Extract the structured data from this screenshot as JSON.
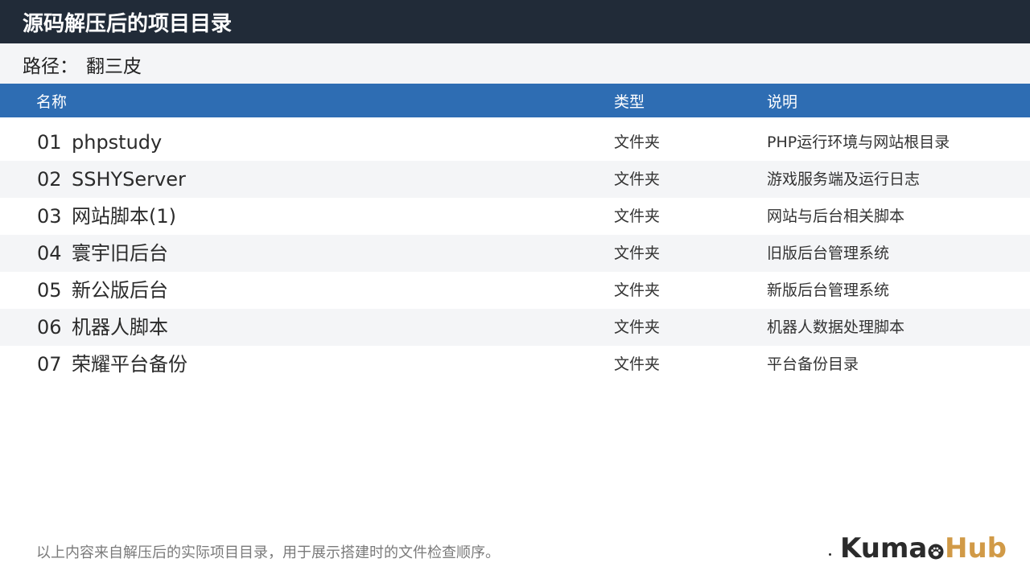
{
  "header": {
    "title": "源码解压后的项目目录"
  },
  "path": {
    "label": "路径：",
    "value": "翻三皮"
  },
  "table": {
    "columns": {
      "name": "名称",
      "type": "类型",
      "desc": "说明"
    },
    "rows": [
      {
        "num": "01",
        "name": "phpstudy",
        "type": "文件夹",
        "desc": "PHP运行环境与网站根目录"
      },
      {
        "num": "02",
        "name": "SSHYServer",
        "type": "文件夹",
        "desc": "游戏服务端及运行日志"
      },
      {
        "num": "03",
        "name": "网站脚本(1)",
        "type": "文件夹",
        "desc": "网站与后台相关脚本"
      },
      {
        "num": "04",
        "name": "寰宇旧后台",
        "type": "文件夹",
        "desc": "旧版后台管理系统"
      },
      {
        "num": "05",
        "name": "新公版后台",
        "type": "文件夹",
        "desc": "新版后台管理系统"
      },
      {
        "num": "06",
        "name": "机器人脚本",
        "type": "文件夹",
        "desc": "机器人数据处理脚本"
      },
      {
        "num": "07",
        "name": "荣耀平台备份",
        "type": "文件夹",
        "desc": "平台备份目录"
      }
    ]
  },
  "footer": {
    "note": "以上内容来自解压后的实际项目目录，用于展示搭建时的文件检查顺序。"
  },
  "logo": {
    "part1": "Kuma",
    "part2": "Hub",
    "icon": "paw-icon",
    "accent_color": "#d19a47"
  },
  "colors": {
    "titlebar": "#212b38",
    "table_header": "#2e6db3",
    "alt_row": "#f4f5f7"
  }
}
